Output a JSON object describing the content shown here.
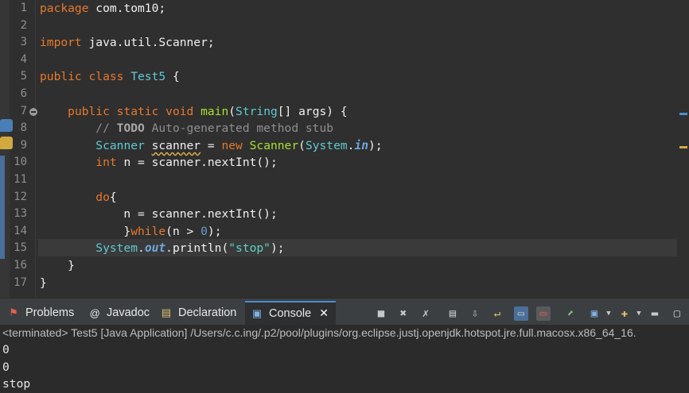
{
  "editor": {
    "lines": [
      {
        "n": "1",
        "tokens": [
          [
            "kw",
            "package "
          ],
          [
            "var",
            "com.tom10;"
          ]
        ]
      },
      {
        "n": "2",
        "tokens": []
      },
      {
        "n": "3",
        "tokens": [
          [
            "kw",
            "import "
          ],
          [
            "var",
            "java.util.Scanner;"
          ]
        ]
      },
      {
        "n": "4",
        "tokens": []
      },
      {
        "n": "5",
        "tokens": [
          [
            "kw",
            "public class "
          ],
          [
            "cls",
            "Test5"
          ],
          [
            "var",
            " {"
          ]
        ]
      },
      {
        "n": "6",
        "tokens": []
      },
      {
        "n": "7",
        "tokens": [
          [
            "var",
            "    "
          ],
          [
            "kw",
            "public static void "
          ],
          [
            "mth",
            "main"
          ],
          [
            "var",
            "("
          ],
          [
            "cls",
            "String"
          ],
          [
            "var",
            "[] "
          ],
          [
            "var",
            "args"
          ],
          [
            "var",
            ") {"
          ]
        ]
      },
      {
        "n": "8",
        "tokens": [
          [
            "var",
            "        "
          ],
          [
            "cmt",
            "// "
          ],
          [
            "todo",
            "TODO"
          ],
          [
            "cmt",
            " Auto-generated method stub"
          ]
        ]
      },
      {
        "n": "9",
        "tokens": [
          [
            "var",
            "        "
          ],
          [
            "cls",
            "Scanner "
          ],
          [
            "warn",
            "scanner"
          ],
          [
            "var",
            " = "
          ],
          [
            "kw",
            "new "
          ],
          [
            "mth",
            "Scanner"
          ],
          [
            "var",
            "("
          ],
          [
            "cls",
            "System"
          ],
          [
            "var",
            "."
          ],
          [
            "fld",
            "in"
          ],
          [
            "var",
            ");"
          ]
        ]
      },
      {
        "n": "10",
        "tokens": [
          [
            "var",
            "        "
          ],
          [
            "kw",
            "int "
          ],
          [
            "var",
            "n = scanner.nextInt();"
          ]
        ]
      },
      {
        "n": "11",
        "tokens": []
      },
      {
        "n": "12",
        "tokens": [
          [
            "var",
            "        "
          ],
          [
            "kw",
            "do"
          ],
          [
            "var",
            "{"
          ]
        ]
      },
      {
        "n": "13",
        "tokens": [
          [
            "var",
            "            n = scanner.nextInt();"
          ]
        ]
      },
      {
        "n": "14",
        "tokens": [
          [
            "var",
            "            }"
          ],
          [
            "kw",
            "while"
          ],
          [
            "var",
            "(n > "
          ],
          [
            "num",
            "0"
          ],
          [
            "var",
            ");"
          ]
        ]
      },
      {
        "n": "15",
        "tokens": [
          [
            "var",
            "        "
          ],
          [
            "cls",
            "System"
          ],
          [
            "var",
            "."
          ],
          [
            "fld",
            "out"
          ],
          [
            "var",
            ".println("
          ],
          [
            "str",
            "\"stop\""
          ],
          [
            "var",
            ");"
          ]
        ]
      },
      {
        "n": "16",
        "tokens": [
          [
            "var",
            "    }"
          ]
        ]
      },
      {
        "n": "17",
        "tokens": [
          [
            "var",
            "}"
          ]
        ]
      }
    ]
  },
  "views": {
    "tabs": [
      {
        "label": "Problems",
        "icon": "problems-icon",
        "glyph": "⚑"
      },
      {
        "label": "Javadoc",
        "icon": "javadoc-icon",
        "glyph": "@"
      },
      {
        "label": "Declaration",
        "icon": "declaration-icon",
        "glyph": "▤"
      },
      {
        "label": "Console",
        "icon": "console-icon",
        "glyph": "▣",
        "active": true
      }
    ],
    "close_glyph": "✕"
  },
  "console": {
    "status": "<terminated> Test5 [Java Application] /Users/c.c.ing/.p2/pool/plugins/org.eclipse.justj.openjdk.hotspot.jre.full.macosx.x86_64_16.",
    "output": [
      "0",
      "0",
      "stop"
    ]
  },
  "colors": {
    "editor_bg": "#2f2f2f",
    "keyword": "#e6792d",
    "type": "#5fcbd3",
    "string": "#5fd3c2",
    "method": "#a6e22e",
    "active_tab": "#4d8ecf"
  }
}
